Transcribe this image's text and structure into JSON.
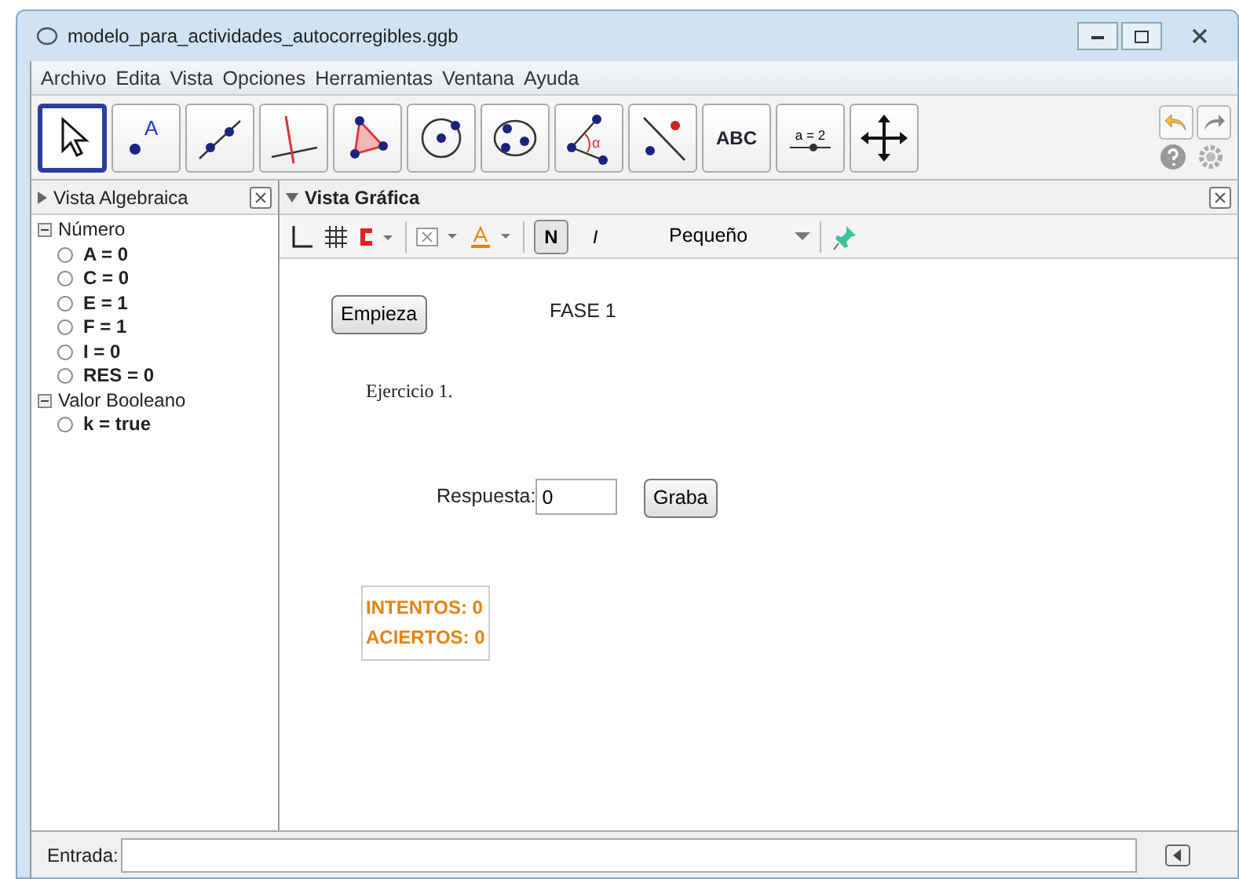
{
  "window": {
    "title": "modelo_para_actividades_autocorregibles.ggb"
  },
  "menu": [
    "Archivo",
    "Edita",
    "Vista",
    "Opciones",
    "Herramientas",
    "Ventana",
    "Ayuda"
  ],
  "tools": [
    {
      "kind": "move",
      "selected": true
    },
    {
      "kind": "point",
      "label": "A",
      "selected": false
    },
    {
      "kind": "line",
      "selected": false
    },
    {
      "kind": "perpendicular",
      "selected": false
    },
    {
      "kind": "polygon",
      "selected": false
    },
    {
      "kind": "circle",
      "selected": false
    },
    {
      "kind": "conic",
      "selected": false
    },
    {
      "kind": "angle",
      "label": "α",
      "selected": false
    },
    {
      "kind": "reflect",
      "selected": false
    },
    {
      "kind": "text",
      "label": "ABC",
      "selected": false
    },
    {
      "kind": "slider",
      "label": "a = 2",
      "selected": false
    },
    {
      "kind": "pan",
      "selected": false
    }
  ],
  "algebra_view": {
    "title": "Vista Algebraica",
    "groups": [
      {
        "label": "Número",
        "expanded": true,
        "children": [
          {
            "label": "A = 0"
          },
          {
            "label": "C = 0"
          },
          {
            "label": "E = 1"
          },
          {
            "label": "F = 1"
          },
          {
            "label": "I = 0"
          },
          {
            "label": "RES = 0"
          }
        ]
      },
      {
        "label": "Valor Booleano",
        "expanded": true,
        "children": [
          {
            "label": "k = true"
          }
        ]
      }
    ]
  },
  "graphics_view": {
    "title": "Vista Gráfica",
    "style_bar": {
      "bold": {
        "label": "N",
        "selected": true
      },
      "italic": {
        "label": "I",
        "selected": false
      },
      "size": "Pequeño"
    },
    "objects": [
      {
        "kind": "button",
        "text": "Empieza"
      },
      {
        "kind": "text",
        "text": "FASE 1"
      },
      {
        "kind": "serif",
        "text": "Ejercicio 1."
      },
      {
        "kind": "input",
        "label": "Respuesta:",
        "value": "0"
      },
      {
        "kind": "button",
        "text": "Graba"
      },
      {
        "kind": "counter",
        "lines": [
          "INTENTOS: 0",
          "ACIERTOS: 0"
        ]
      }
    ]
  },
  "input_bar": {
    "label": "Entrada:"
  }
}
